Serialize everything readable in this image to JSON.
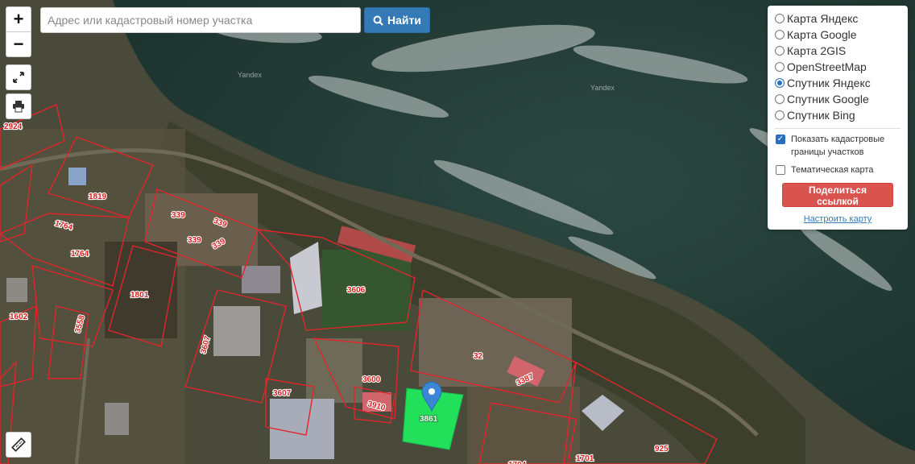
{
  "search": {
    "placeholder": "Адрес или кадастровый номер участка",
    "button_label": "Найти"
  },
  "zoom": {
    "in": "+",
    "out": "−"
  },
  "tools": {
    "fullscreen_icon": "expand-icon",
    "print_icon": "printer-icon",
    "ruler_icon": "ruler-icon"
  },
  "layers": {
    "options": [
      {
        "label": "Карта Яндекс",
        "checked": false
      },
      {
        "label": "Карта Google",
        "checked": false
      },
      {
        "label": "Карта 2GIS",
        "checked": false
      },
      {
        "label": "OpenStreetMap",
        "checked": false
      },
      {
        "label": "Спутник Яндекс",
        "checked": true
      },
      {
        "label": "Спутник Google",
        "checked": false
      },
      {
        "label": "Спутник Bing",
        "checked": false
      }
    ],
    "show_cadastral": "Показать кадастровые границы участков",
    "thematic": "Тематическая карта",
    "share_button": "Поделиться ссылкой",
    "setup_link": "Настроить карту"
  },
  "watermarks": [
    "Yandex",
    "Yandex"
  ],
  "parcel_labels": [
    "2924",
    "1819",
    "1764",
    "1764",
    "339",
    "339",
    "339",
    "339",
    "1801",
    "1602",
    "3558",
    "3606",
    "3607",
    "3600",
    "3607",
    "3910",
    "32",
    "3387",
    "3861",
    "925",
    "1701",
    "1704"
  ],
  "colors": {
    "boundary": "#e0262c",
    "selected_parcel": "#22e05a",
    "marker": "#3b87d6",
    "water": "#233b35"
  }
}
